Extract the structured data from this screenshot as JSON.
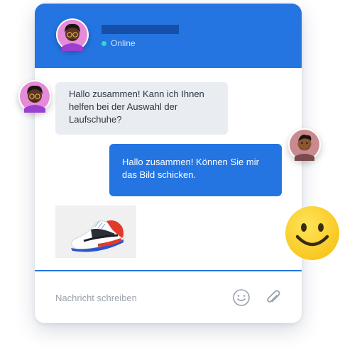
{
  "header": {
    "contact_name": "",
    "status": "Online"
  },
  "messages": [
    {
      "from": "agent",
      "text": "Hallo zusammen! Kann ich Ihnen helfen bei der Auswahl der Laufschuhe?"
    },
    {
      "from": "user",
      "text": "Hallo zusammen! Können Sie mir das Bild schicken."
    }
  ],
  "composer": {
    "placeholder": "Nachricht schreiben"
  },
  "colors": {
    "accent": "#2475e2",
    "online": "#37d6c8",
    "incoming_bubble": "#e9edf2"
  },
  "icons": [
    "emoji-icon",
    "paperclip-icon",
    "smiley-emoji-icon"
  ]
}
